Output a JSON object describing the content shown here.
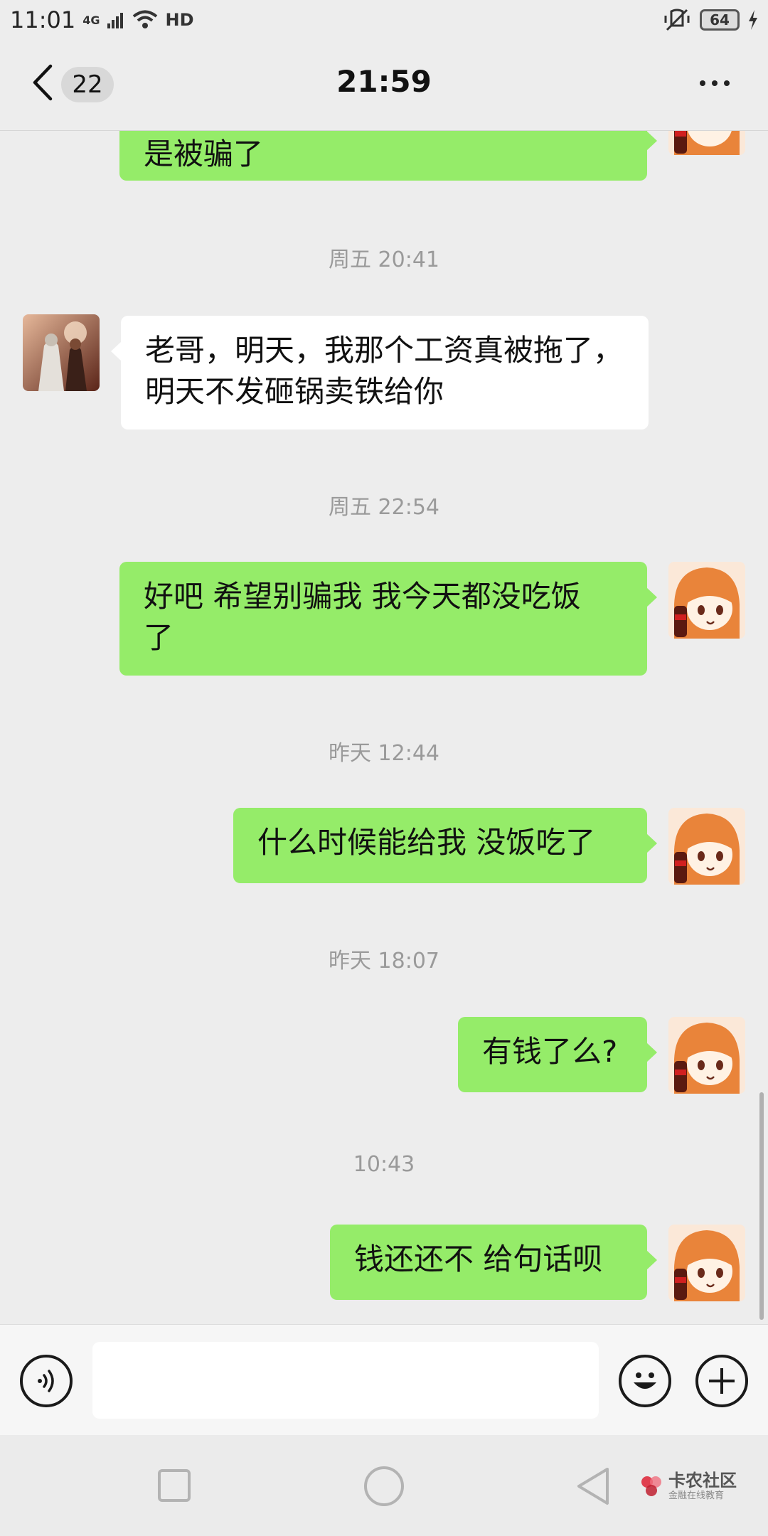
{
  "status_bar": {
    "time": "11:01",
    "network": "4G",
    "hd": "HD",
    "battery": "64"
  },
  "header": {
    "unread_count": "22",
    "title": "21:59"
  },
  "chat": {
    "messages": [
      {
        "type": "text",
        "from": "me",
        "text": "是被骗了"
      },
      {
        "type": "timestamp",
        "text": "周五 20:41"
      },
      {
        "type": "text",
        "from": "other",
        "lines": [
          "老哥，明天，我那个工资真被拖了，",
          "明天不发砸锅卖铁给你"
        ]
      },
      {
        "type": "timestamp",
        "text": "周五 22:54"
      },
      {
        "type": "text",
        "from": "me",
        "lines": [
          "好吧  希望别骗我 我今天都没吃饭",
          "了"
        ]
      },
      {
        "type": "timestamp",
        "text": "昨天 12:44"
      },
      {
        "type": "text",
        "from": "me",
        "text": "什么时候能给我  没饭吃了"
      },
      {
        "type": "timestamp",
        "text": "昨天 18:07"
      },
      {
        "type": "text",
        "from": "me",
        "text": "有钱了么?"
      },
      {
        "type": "timestamp",
        "text": "10:43"
      },
      {
        "type": "text",
        "from": "me",
        "text": "钱还还不  给句话呗"
      }
    ]
  },
  "input_bar": {
    "value": "",
    "placeholder": ""
  },
  "watermark": {
    "main": "卡农社区",
    "sub": "金融在线教育"
  },
  "colors": {
    "background": "#ededed",
    "outgoing_bubble": "#95ec69",
    "incoming_bubble": "#ffffff",
    "timestamp_text": "#9a9a9a"
  },
  "icons": {
    "back": "chevron-left-icon",
    "more": "more-dots-icon",
    "voice": "voice-icon",
    "emoji": "emoji-icon",
    "plus": "plus-icon",
    "nav_recent": "recent-apps-icon",
    "nav_home": "home-icon",
    "nav_back": "nav-back-icon"
  }
}
